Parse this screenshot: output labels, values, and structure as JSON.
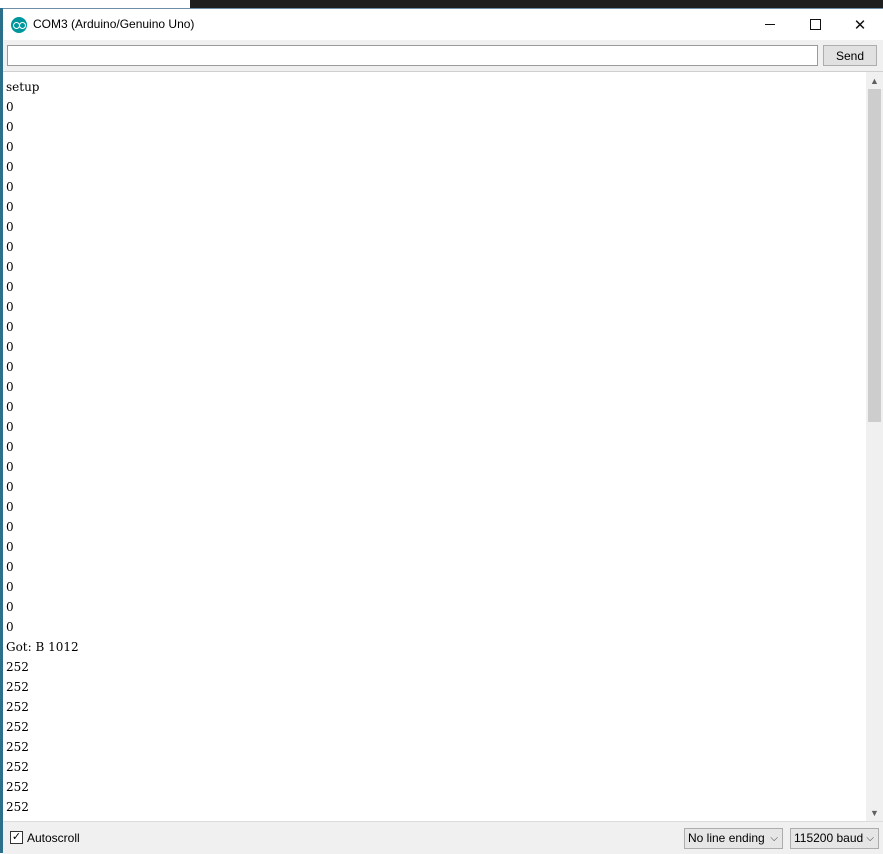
{
  "window": {
    "title": "COM3 (Arduino/Genuino Uno)",
    "icon": "arduino-icon",
    "controls": {
      "minimize": "minimize-icon",
      "maximize": "maximize-icon",
      "close": "✕"
    }
  },
  "toolbar": {
    "input_value": "",
    "send_label": "Send"
  },
  "output": {
    "lines": [
      "setup",
      "0",
      "0",
      "0",
      "0",
      "0",
      "0",
      "0",
      "0",
      "0",
      "0",
      "0",
      "0",
      "0",
      "0",
      "0",
      "0",
      "0",
      "0",
      "0",
      "0",
      "0",
      "0",
      "0",
      "0",
      "0",
      "0",
      "0",
      "Got: B 1012",
      "252",
      "252",
      "252",
      "252",
      "252",
      "252",
      "252",
      "252"
    ]
  },
  "scrollbar": {
    "up_icon": "▲",
    "down_icon": "▼"
  },
  "status": {
    "autoscroll_checked": true,
    "autoscroll_check_glyph": "✓",
    "autoscroll_label": "Autoscroll",
    "line_ending": "No line ending",
    "baud": "115200 baud",
    "chevron_glyph": "⌵"
  }
}
